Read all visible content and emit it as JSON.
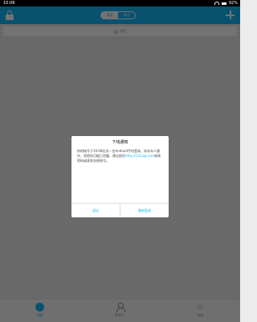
{
  "status_bar": {
    "time": "10:08",
    "battery": "92%"
  },
  "header": {
    "tabs": [
      "消息",
      "电话"
    ],
    "active_tab": 0
  },
  "search": {
    "placeholder": "搜索"
  },
  "tab_bar": {
    "items": [
      "消息",
      "联系人",
      "动态"
    ],
    "active_index": 0
  },
  "dialog": {
    "title": "下线通知",
    "message_before": "你的帐号于10:08在另一台Android手机登录。如非本人操作，则密码可能已泄露，建议前往",
    "link": "http://110.qq.com",
    "message_after": "修改密码或紧急冻结帐号。",
    "cancel_label": "退出",
    "confirm_label": "重新登录"
  },
  "colors": {
    "accent": "#12b7f5"
  },
  "icons": [
    "lock-icon",
    "plus-icon",
    "search-icon",
    "message-icon",
    "contacts-icon",
    "star-icon",
    "wifi-icon",
    "battery-icon"
  ]
}
